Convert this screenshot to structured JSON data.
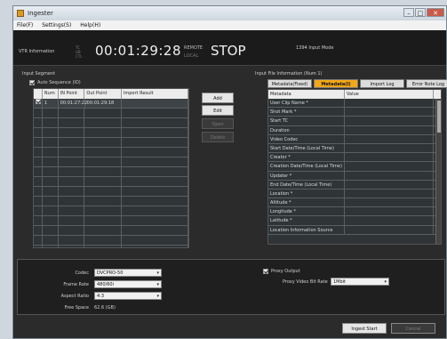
{
  "window": {
    "title": "Ingester",
    "min": "–",
    "max": "□",
    "close": "✕"
  },
  "menu": [
    {
      "label": "File(F)"
    },
    {
      "label": "Settings(S)"
    },
    {
      "label": "Help(H)"
    }
  ],
  "status": {
    "vtr_info_label": "VTR Information",
    "tc_labels": [
      "TC",
      "UB",
      "CTL"
    ],
    "timecode": "00:01:29:28",
    "remote_label": "REMOTE",
    "local_label": "LOCAL",
    "state": "STOP",
    "mode_label": "1394 Input Mode"
  },
  "input_segment": {
    "heading": "Input Segment",
    "auto_sequence_label": "Auto Sequence (IO)",
    "columns": [
      "",
      "Num",
      "IN Point",
      "Out Point",
      "Import Result"
    ],
    "rows": [
      {
        "num": "1",
        "in": "00:01:27:22",
        "out": "00:01:29:18",
        "result": ""
      }
    ],
    "buttons": [
      {
        "label": "Add",
        "enabled": true
      },
      {
        "label": "Edit",
        "enabled": true
      },
      {
        "label": "Open",
        "enabled": false
      },
      {
        "label": "Delete",
        "enabled": false
      }
    ]
  },
  "file_info": {
    "heading": "Input File Information (Num 1)",
    "tabs": [
      {
        "label": "Metadata(Fixed)",
        "selected": false
      },
      {
        "label": "Metadata(I)",
        "selected": true
      },
      {
        "label": "Import Log",
        "selected": false
      },
      {
        "label": "Error Note Log",
        "selected": false
      }
    ],
    "columns": [
      "Metadata",
      "Value"
    ],
    "rows": [
      {
        "key": "User Clip Name *",
        "value": ""
      },
      {
        "key": "Shot Mark *",
        "value": ""
      },
      {
        "key": "Start TC",
        "value": ""
      },
      {
        "key": "Duration",
        "value": ""
      },
      {
        "key": "Video Codec",
        "value": ""
      },
      {
        "key": "Start Date/Time (Local Time)",
        "value": ""
      },
      {
        "key": "Creator *",
        "value": ""
      },
      {
        "key": "Creation Date/Time (Local Time)",
        "value": ""
      },
      {
        "key": "Updater *",
        "value": ""
      },
      {
        "key": "End Date/Time (Local Time)",
        "value": ""
      },
      {
        "key": "Location *",
        "value": ""
      },
      {
        "key": "Altitude *",
        "value": ""
      },
      {
        "key": "Longitude *",
        "value": ""
      },
      {
        "key": "Latitude *",
        "value": ""
      },
      {
        "key": "Location Information Source",
        "value": ""
      }
    ]
  },
  "settings": {
    "codec_label": "Codec",
    "codec_value": "DVCPRO-50",
    "frame_rate_label": "Frame Rate",
    "frame_rate_value": "480/60i",
    "aspect_label": "Aspect Ratio",
    "aspect_value": "4:3",
    "free_space_label": "Free Space",
    "free_space_value": "62.6 (GB)",
    "proxy_output_label": "Proxy Output",
    "proxy_rate_label": "Proxy Video Bit Rate",
    "proxy_rate_value": "1Mbit"
  },
  "footer": {
    "ingest_start": "Ingest Start",
    "cancel": "Cancel"
  }
}
